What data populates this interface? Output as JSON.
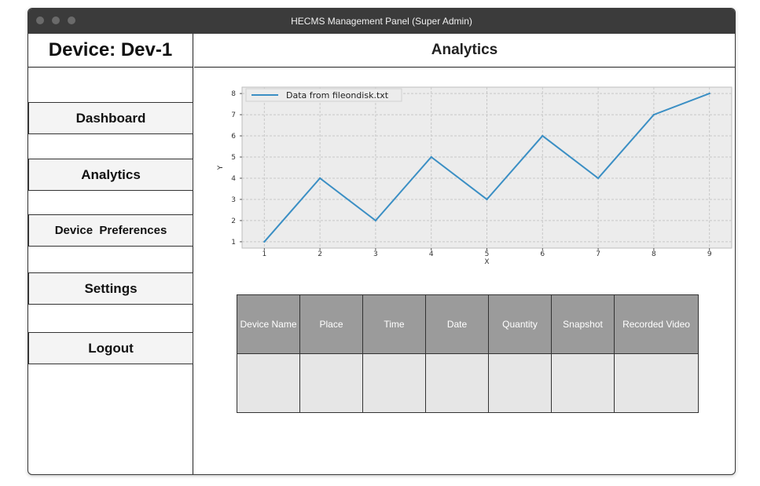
{
  "window": {
    "title": "HECMS Management Panel (Super Admin)"
  },
  "sidebar": {
    "device_title": "Device: Dev-1",
    "items": [
      {
        "label": "Dashboard"
      },
      {
        "label": "Analytics"
      },
      {
        "label": "Device  Preferences"
      },
      {
        "label": "Settings"
      },
      {
        "label": "Logout"
      }
    ]
  },
  "main": {
    "title": "Analytics"
  },
  "chart_data": {
    "type": "line",
    "x": [
      1,
      2,
      3,
      4,
      5,
      6,
      7,
      8,
      9
    ],
    "series": [
      {
        "name": "Data from fileondisk.txt",
        "values": [
          1,
          4,
          2,
          5,
          3,
          6,
          4,
          7,
          8
        ]
      }
    ],
    "title": "",
    "xlabel": "X",
    "ylabel": "Y",
    "xlim": [
      0.6,
      9.4
    ],
    "ylim": [
      0.7,
      8.3
    ],
    "xticks": [
      1,
      2,
      3,
      4,
      5,
      6,
      7,
      8,
      9
    ],
    "yticks": [
      1,
      2,
      3,
      4,
      5,
      6,
      7,
      8
    ],
    "grid": true,
    "legend": "top-left",
    "colors": {
      "line": "#3b8fc4",
      "plot_bg": "#ececec",
      "grid": "#c8c8c8"
    }
  },
  "table": {
    "headers": [
      "Device Name",
      "Place",
      "Time",
      "Date",
      "Quantity",
      "Snapshot",
      "Recorded Video"
    ],
    "rows": [
      [
        "",
        "",
        "",
        "",
        "",
        "",
        ""
      ]
    ]
  }
}
